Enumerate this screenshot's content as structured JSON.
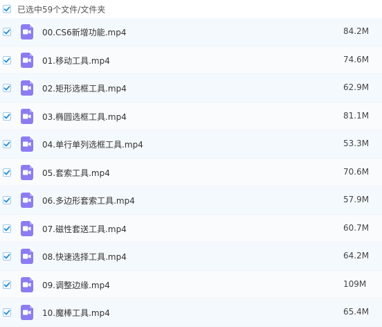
{
  "header": {
    "selection_text": "已选中59个文件/文件夹",
    "checked": true
  },
  "colors": {
    "accent": "#1a8bd8",
    "video_icon": "#8b7cf0",
    "row_bg": "#f4f9fd"
  },
  "files": [
    {
      "name": "00.CS6新增功能.mp4",
      "size": "84.2M",
      "icon": "video-file-icon",
      "checked": true
    },
    {
      "name": "01.移动工具.mp4",
      "size": "74.6M",
      "icon": "video-file-icon",
      "checked": true
    },
    {
      "name": "02.矩形选框工具.mp4",
      "size": "62.9M",
      "icon": "video-file-icon",
      "checked": true
    },
    {
      "name": "03.椭圆选框工具.mp4",
      "size": "81.1M",
      "icon": "video-file-icon",
      "checked": true
    },
    {
      "name": "04.单行单列选框工具.mp4",
      "size": "53.3M",
      "icon": "video-file-icon",
      "checked": true
    },
    {
      "name": "05.套索工具.mp4",
      "size": "70.6M",
      "icon": "video-file-icon",
      "checked": true
    },
    {
      "name": "06.多边形套索工具.mp4",
      "size": "57.9M",
      "icon": "video-file-icon",
      "checked": true
    },
    {
      "name": "07.磁性套送工具.mp4",
      "size": "60.7M",
      "icon": "video-file-icon",
      "checked": true
    },
    {
      "name": "08.快速选择工具.mp4",
      "size": "64.2M",
      "icon": "video-file-icon",
      "checked": true
    },
    {
      "name": "09.调整边缘.mp4",
      "size": "109M",
      "icon": "video-file-icon",
      "checked": true
    },
    {
      "name": "10.魔棒工具.mp4",
      "size": "65.4M",
      "icon": "video-file-icon",
      "checked": true
    }
  ]
}
